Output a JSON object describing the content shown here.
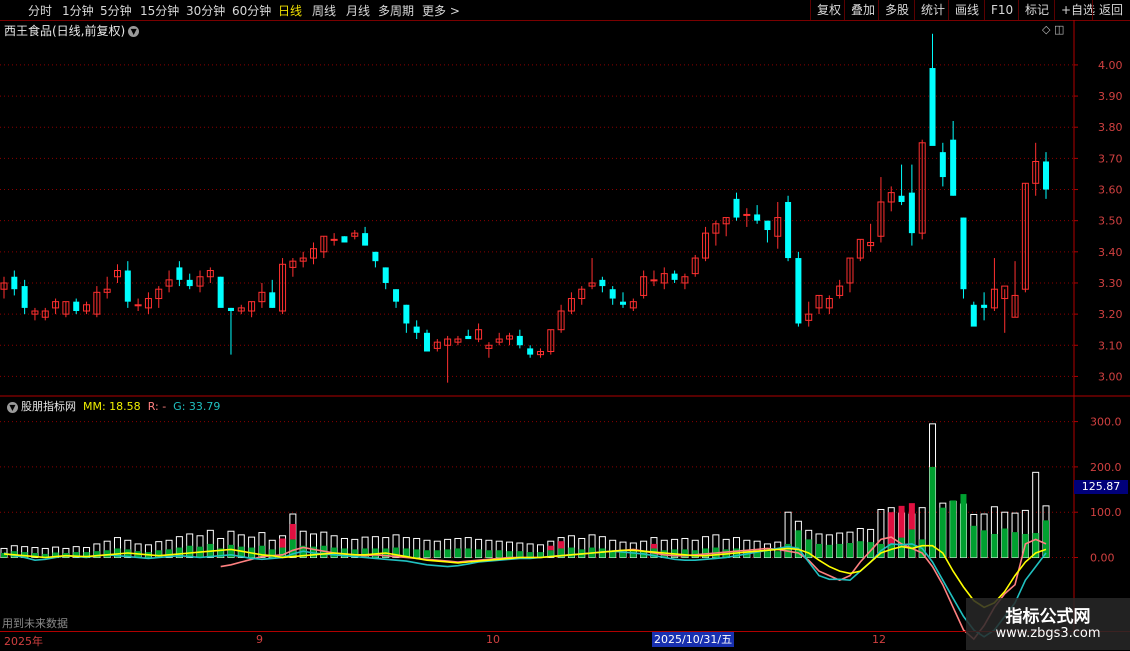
{
  "toolbar": {
    "timeframes": [
      {
        "label": "分时",
        "active": false
      },
      {
        "label": "1分钟",
        "active": false
      },
      {
        "label": "5分钟",
        "active": false
      },
      {
        "label": "15分钟",
        "active": false
      },
      {
        "label": "30分钟",
        "active": false
      },
      {
        "label": "60分钟",
        "active": false
      },
      {
        "label": "日线",
        "active": true
      },
      {
        "label": "周线",
        "active": false
      },
      {
        "label": "月线",
        "active": false
      },
      {
        "label": "多周期",
        "active": false
      },
      {
        "label": "更多 >",
        "active": false
      }
    ],
    "buttons": [
      "复权",
      "叠加",
      "多股",
      "统计",
      "画线",
      "F10",
      "标记",
      "+自选",
      "返回"
    ]
  },
  "stock_title": "西王食品(日线,前复权)",
  "indicator": {
    "name": "股朋指标网",
    "mm_label": "MM: 18.58",
    "r_label": "R: -",
    "g_label": "G: 33.79"
  },
  "future_note": "用到未来数据",
  "vol_badge": "125.87",
  "date_axis": [
    "2025年",
    "9",
    "10",
    "12"
  ],
  "date_highlight": "2025/10/31/五",
  "watermark": {
    "title": "指标公式网",
    "url": "www.zbgs3.com"
  },
  "colors": {
    "up": "#ff3030",
    "down": "#00ffff",
    "grid": "#8a0000",
    "border": "#b00000",
    "mm": "#ffff00",
    "g": "#20c0c0",
    "r": "#ff8080",
    "bar_green": "#00a030",
    "bar_red": "#e01040"
  },
  "chart_data": [
    {
      "type": "candlestick",
      "ylim": [
        2.95,
        4.08
      ],
      "y_ticks": [
        "4.00",
        "3.90",
        "3.80",
        "3.70",
        "3.60",
        "3.50",
        "3.40",
        "3.30",
        "3.20",
        "3.10",
        "3.00"
      ],
      "ohlc": [
        [
          3.28,
          3.32,
          3.25,
          3.3
        ],
        [
          3.32,
          3.34,
          3.26,
          3.28
        ],
        [
          3.29,
          3.31,
          3.2,
          3.22
        ],
        [
          3.2,
          3.22,
          3.18,
          3.21
        ],
        [
          3.19,
          3.22,
          3.18,
          3.21
        ],
        [
          3.22,
          3.25,
          3.2,
          3.24
        ],
        [
          3.2,
          3.24,
          3.19,
          3.24
        ],
        [
          3.24,
          3.25,
          3.2,
          3.21
        ],
        [
          3.21,
          3.24,
          3.2,
          3.23
        ],
        [
          3.2,
          3.29,
          3.19,
          3.27
        ],
        [
          3.27,
          3.32,
          3.25,
          3.28
        ],
        [
          3.32,
          3.36,
          3.3,
          3.34
        ],
        [
          3.34,
          3.37,
          3.22,
          3.24
        ],
        [
          3.23,
          3.25,
          3.21,
          3.23
        ],
        [
          3.22,
          3.27,
          3.2,
          3.25
        ],
        [
          3.25,
          3.29,
          3.22,
          3.28
        ],
        [
          3.29,
          3.34,
          3.27,
          3.31
        ],
        [
          3.35,
          3.37,
          3.29,
          3.31
        ],
        [
          3.31,
          3.33,
          3.28,
          3.29
        ],
        [
          3.29,
          3.34,
          3.27,
          3.32
        ],
        [
          3.32,
          3.35,
          3.3,
          3.34
        ],
        [
          3.32,
          3.32,
          3.23,
          3.22
        ],
        [
          3.22,
          3.22,
          3.07,
          3.21
        ],
        [
          3.21,
          3.23,
          3.2,
          3.22
        ],
        [
          3.21,
          3.24,
          3.19,
          3.24
        ],
        [
          3.24,
          3.3,
          3.22,
          3.27
        ],
        [
          3.27,
          3.31,
          3.22,
          3.22
        ],
        [
          3.21,
          3.38,
          3.2,
          3.36
        ],
        [
          3.35,
          3.38,
          3.32,
          3.37
        ],
        [
          3.37,
          3.4,
          3.35,
          3.38
        ],
        [
          3.38,
          3.43,
          3.36,
          3.41
        ],
        [
          3.4,
          3.45,
          3.38,
          3.45
        ],
        [
          3.44,
          3.46,
          3.42,
          3.44
        ],
        [
          3.45,
          3.45,
          3.43,
          3.43
        ],
        [
          3.45,
          3.47,
          3.44,
          3.46
        ],
        [
          3.46,
          3.48,
          3.42,
          3.42
        ],
        [
          3.4,
          3.4,
          3.35,
          3.37
        ],
        [
          3.35,
          3.35,
          3.28,
          3.3
        ],
        [
          3.28,
          3.28,
          3.22,
          3.24
        ],
        [
          3.23,
          3.23,
          3.14,
          3.17
        ],
        [
          3.16,
          3.18,
          3.12,
          3.14
        ],
        [
          3.14,
          3.15,
          3.1,
          3.08
        ],
        [
          3.09,
          3.12,
          3.08,
          3.11
        ],
        [
          3.1,
          3.13,
          2.98,
          3.12
        ],
        [
          3.11,
          3.13,
          3.1,
          3.12
        ],
        [
          3.13,
          3.15,
          3.12,
          3.12
        ],
        [
          3.12,
          3.17,
          3.11,
          3.15
        ],
        [
          3.09,
          3.11,
          3.06,
          3.1
        ],
        [
          3.11,
          3.14,
          3.1,
          3.12
        ],
        [
          3.12,
          3.14,
          3.1,
          3.13
        ],
        [
          3.13,
          3.15,
          3.09,
          3.1
        ],
        [
          3.09,
          3.1,
          3.06,
          3.07
        ],
        [
          3.07,
          3.09,
          3.06,
          3.08
        ],
        [
          3.08,
          3.15,
          3.07,
          3.15
        ],
        [
          3.15,
          3.23,
          3.14,
          3.21
        ],
        [
          3.21,
          3.27,
          3.2,
          3.25
        ],
        [
          3.25,
          3.29,
          3.23,
          3.28
        ],
        [
          3.29,
          3.38,
          3.28,
          3.3
        ],
        [
          3.31,
          3.32,
          3.27,
          3.29
        ],
        [
          3.28,
          3.29,
          3.23,
          3.25
        ],
        [
          3.24,
          3.27,
          3.22,
          3.23
        ],
        [
          3.22,
          3.25,
          3.21,
          3.24
        ],
        [
          3.26,
          3.34,
          3.25,
          3.32
        ],
        [
          3.31,
          3.34,
          3.29,
          3.31
        ],
        [
          3.3,
          3.35,
          3.28,
          3.33
        ],
        [
          3.33,
          3.34,
          3.3,
          3.31
        ],
        [
          3.3,
          3.33,
          3.28,
          3.32
        ],
        [
          3.33,
          3.39,
          3.32,
          3.38
        ],
        [
          3.38,
          3.48,
          3.37,
          3.46
        ],
        [
          3.46,
          3.5,
          3.42,
          3.49
        ],
        [
          3.49,
          3.51,
          3.45,
          3.51
        ],
        [
          3.57,
          3.59,
          3.5,
          3.51
        ],
        [
          3.52,
          3.54,
          3.48,
          3.52
        ],
        [
          3.52,
          3.55,
          3.49,
          3.5
        ],
        [
          3.5,
          3.5,
          3.43,
          3.47
        ],
        [
          3.45,
          3.56,
          3.41,
          3.51
        ],
        [
          3.56,
          3.58,
          3.37,
          3.38
        ],
        [
          3.38,
          3.4,
          3.16,
          3.17
        ],
        [
          3.18,
          3.24,
          3.16,
          3.2
        ],
        [
          3.22,
          3.26,
          3.2,
          3.26
        ],
        [
          3.22,
          3.26,
          3.2,
          3.25
        ],
        [
          3.26,
          3.31,
          3.25,
          3.29
        ],
        [
          3.3,
          3.38,
          3.27,
          3.38
        ],
        [
          3.38,
          3.44,
          3.37,
          3.44
        ],
        [
          3.42,
          3.49,
          3.4,
          3.43
        ],
        [
          3.45,
          3.64,
          3.43,
          3.56
        ],
        [
          3.56,
          3.61,
          3.53,
          3.59
        ],
        [
          3.58,
          3.68,
          3.55,
          3.56
        ],
        [
          3.59,
          3.68,
          3.42,
          3.46
        ],
        [
          3.46,
          3.76,
          3.44,
          3.75
        ],
        [
          3.99,
          4.1,
          3.75,
          3.74
        ],
        [
          3.72,
          3.75,
          3.61,
          3.64
        ],
        [
          3.76,
          3.82,
          3.58,
          3.58
        ],
        [
          3.51,
          3.51,
          3.25,
          3.28
        ],
        [
          3.23,
          3.24,
          3.17,
          3.16
        ],
        [
          3.23,
          3.27,
          3.18,
          3.22
        ],
        [
          3.22,
          3.38,
          3.21,
          3.28
        ],
        [
          3.25,
          3.28,
          3.14,
          3.29
        ],
        [
          3.19,
          3.37,
          3.19,
          3.26
        ],
        [
          3.28,
          3.62,
          3.27,
          3.62
        ],
        [
          3.62,
          3.75,
          3.58,
          3.69
        ],
        [
          3.69,
          3.72,
          3.57,
          3.6
        ]
      ]
    },
    {
      "type": "bar+line",
      "ylim": [
        -160,
        330
      ],
      "y_ticks": [
        "300.0",
        "200.0",
        "100.0",
        "0.00"
      ],
      "total": [
        20,
        26,
        24,
        22,
        20,
        23,
        20,
        24,
        22,
        30,
        36,
        44,
        38,
        30,
        28,
        35,
        38,
        46,
        52,
        48,
        60,
        42,
        58,
        50,
        45,
        55,
        38,
        48,
        96,
        58,
        52,
        56,
        48,
        42,
        40,
        45,
        46,
        44,
        50,
        44,
        42,
        38,
        36,
        40,
        42,
        44,
        40,
        38,
        36,
        34,
        32,
        30,
        28,
        36,
        44,
        48,
        42,
        50,
        46,
        38,
        34,
        32,
        36,
        44,
        38,
        40,
        42,
        38,
        46,
        50,
        40,
        44,
        38,
        36,
        30,
        34,
        100,
        80,
        60,
        52,
        50,
        54,
        56,
        64,
        62,
        106,
        110,
        98,
        96,
        110,
        295,
        120,
        124,
        118,
        95,
        96,
        112,
        100,
        98,
        104,
        188,
        114
      ],
      "green_part": [
        10,
        14,
        12,
        10,
        8,
        11,
        10,
        12,
        12,
        14,
        16,
        20,
        18,
        14,
        12,
        16,
        18,
        22,
        26,
        24,
        30,
        20,
        28,
        24,
        22,
        26,
        18,
        22,
        40,
        26,
        24,
        26,
        22,
        20,
        18,
        20,
        20,
        20,
        22,
        20,
        18,
        16,
        16,
        18,
        20,
        20,
        18,
        16,
        16,
        14,
        14,
        12,
        12,
        16,
        20,
        22,
        18,
        22,
        20,
        16,
        14,
        14,
        16,
        20,
        16,
        18,
        18,
        16,
        20,
        22,
        18,
        20,
        16,
        16,
        14,
        14,
        30,
        60,
        40,
        30,
        28,
        30,
        32,
        36,
        34,
        30,
        30,
        44,
        62,
        40,
        200,
        110,
        126,
        140,
        70,
        60,
        52,
        64,
        56,
        52,
        54,
        82
      ],
      "red_part": [
        0,
        0,
        0,
        0,
        0,
        0,
        0,
        0,
        0,
        0,
        0,
        0,
        0,
        0,
        0,
        0,
        0,
        0,
        0,
        0,
        0,
        0,
        0,
        0,
        0,
        0,
        0,
        20,
        34,
        0,
        0,
        0,
        0,
        0,
        0,
        0,
        0,
        0,
        0,
        0,
        0,
        0,
        0,
        0,
        0,
        0,
        0,
        0,
        0,
        0,
        0,
        0,
        0,
        10,
        16,
        0,
        0,
        0,
        0,
        0,
        0,
        0,
        0,
        10,
        0,
        0,
        0,
        0,
        0,
        0,
        0,
        0,
        0,
        0,
        0,
        0,
        0,
        0,
        0,
        0,
        0,
        0,
        0,
        0,
        0,
        0,
        70,
        70,
        58,
        0,
        0,
        0,
        0,
        0,
        0,
        0,
        0,
        0,
        0,
        0,
        0,
        0
      ],
      "mm": [
        8,
        6,
        4,
        2,
        0,
        2,
        4,
        3,
        2,
        4,
        6,
        8,
        10,
        8,
        6,
        4,
        6,
        8,
        10,
        12,
        14,
        16,
        18,
        14,
        10,
        6,
        4,
        0,
        2,
        4,
        6,
        8,
        10,
        8,
        6,
        6,
        8,
        10,
        6,
        2,
        -2,
        -6,
        -8,
        -10,
        -12,
        -10,
        -8,
        -6,
        -4,
        -2,
        0,
        0,
        0,
        2,
        4,
        6,
        8,
        10,
        12,
        14,
        16,
        16,
        14,
        12,
        10,
        8,
        6,
        4,
        4,
        6,
        8,
        10,
        12,
        14,
        16,
        18,
        20,
        18,
        10,
        -6,
        -20,
        -30,
        -35,
        -30,
        -10,
        10,
        18,
        24,
        20,
        26,
        26,
        10,
        -30,
        -65,
        -95,
        -110,
        -100,
        -75,
        -40,
        -10,
        10,
        18
      ],
      "g": [
        10,
        4,
        0,
        -6,
        -4,
        0,
        4,
        2,
        0,
        4,
        6,
        4,
        2,
        0,
        -2,
        0,
        2,
        4,
        2,
        0,
        2,
        4,
        6,
        2,
        -2,
        -4,
        -2,
        0,
        8,
        14,
        10,
        8,
        6,
        4,
        2,
        0,
        -2,
        -4,
        -6,
        -8,
        -12,
        -16,
        -18,
        -20,
        -18,
        -14,
        -10,
        -8,
        -6,
        -4,
        -2,
        -2,
        0,
        2,
        4,
        6,
        8,
        10,
        12,
        14,
        12,
        10,
        8,
        4,
        0,
        -4,
        -6,
        -6,
        -4,
        -2,
        0,
        4,
        8,
        12,
        16,
        20,
        24,
        20,
        -10,
        -40,
        -48,
        -48,
        -50,
        -30,
        -10,
        15,
        30,
        28,
        30,
        20,
        -10,
        -50,
        -90,
        -130,
        -160,
        -175,
        -160,
        -130,
        -100,
        -50,
        -20,
        10
      ],
      "r": [
        null,
        null,
        null,
        null,
        null,
        null,
        null,
        null,
        null,
        null,
        null,
        null,
        null,
        null,
        null,
        null,
        null,
        null,
        null,
        null,
        null,
        -20,
        -16,
        -10,
        -4,
        2,
        4,
        6,
        16,
        22,
        18,
        14,
        10,
        8,
        6,
        4,
        6,
        4,
        2,
        0,
        -2,
        -4,
        -6,
        -8,
        -10,
        -8,
        -6,
        -4,
        -2,
        0,
        0,
        0,
        0,
        2,
        4,
        6,
        8,
        10,
        12,
        14,
        16,
        18,
        14,
        10,
        6,
        4,
        4,
        6,
        8,
        10,
        12,
        14,
        16,
        18,
        20,
        18,
        14,
        10,
        -6,
        -30,
        -40,
        -50,
        -40,
        -10,
        15,
        40,
        45,
        30,
        20,
        10,
        -20,
        -60,
        -110,
        -160,
        -180,
        -150,
        -110,
        -80,
        -60,
        30,
        40,
        30
      ]
    }
  ]
}
